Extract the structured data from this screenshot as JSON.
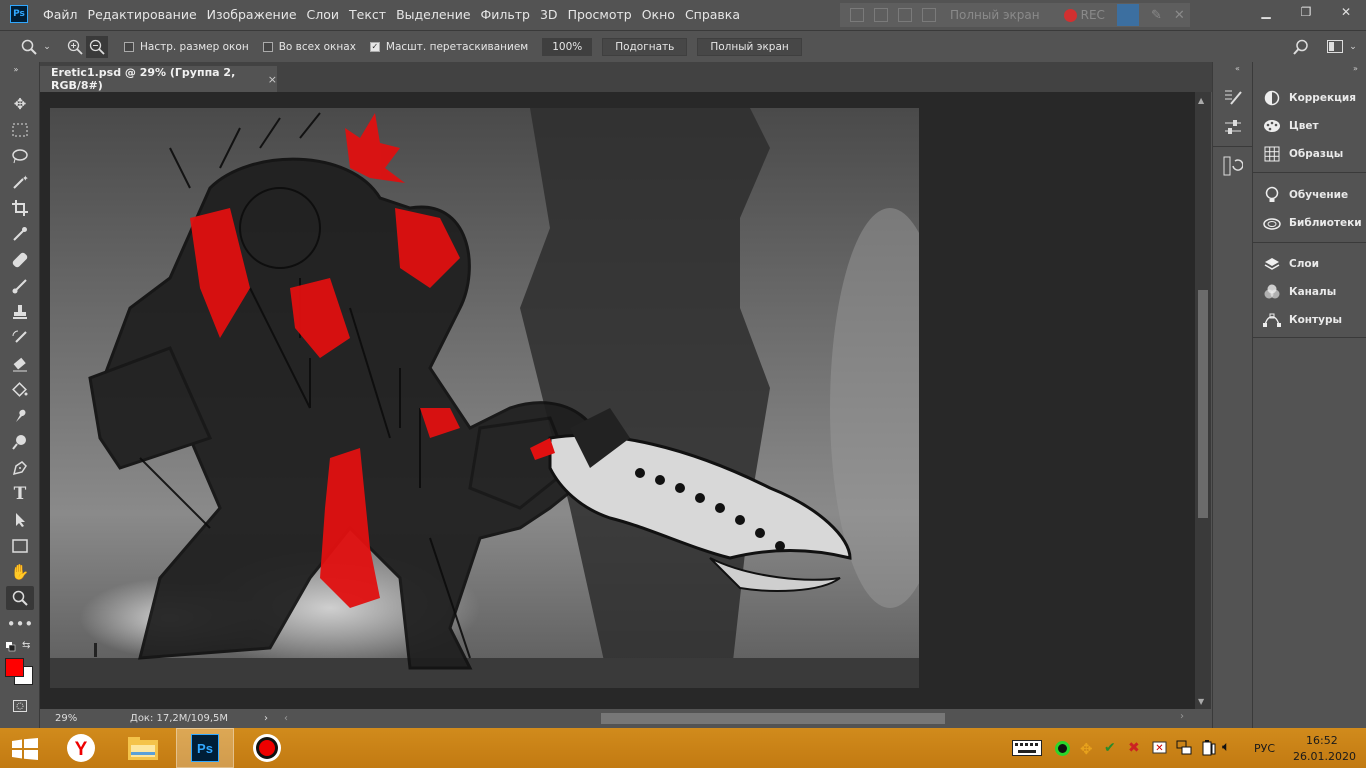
{
  "menu": {
    "items": [
      "Файл",
      "Редактирование",
      "Изображение",
      "Слои",
      "Текст",
      "Выделение",
      "Фильтр",
      "3D",
      "Просмотр",
      "Окно",
      "Справка"
    ]
  },
  "recorder": {
    "fullscreen_label": "Полный экран",
    "rec_label": "REC"
  },
  "options": {
    "resize_windows_label": "Настр. размер окон",
    "resize_windows_checked": false,
    "all_windows_label": "Во всех окнах",
    "all_windows_checked": false,
    "scrubby_zoom_label": "Масшт. перетаскиванием",
    "scrubby_zoom_checked": true,
    "zoom_value": "100%",
    "fit_screen_label": "Подогнать",
    "fill_screen_label": "Полный экран"
  },
  "document": {
    "tab_title": "Eretic1.psd @ 29% (Группа 2, RGB/8#)",
    "close_glyph": "×",
    "zoom": "29%",
    "doc_size": "Док: 17,2M/109,5M"
  },
  "panels": {
    "items": [
      {
        "label": "Коррекция",
        "icon": "adjustments-icon"
      },
      {
        "label": "Цвет",
        "icon": "color-palette-icon"
      },
      {
        "label": "Образцы",
        "icon": "swatches-grid-icon"
      },
      {
        "label": "Обучение",
        "icon": "lightbulb-icon"
      },
      {
        "label": "Библиотеки",
        "icon": "cloud-libraries-icon"
      },
      {
        "label": "Слои",
        "icon": "layers-icon"
      },
      {
        "label": "Каналы",
        "icon": "channels-icon"
      },
      {
        "label": "Контуры",
        "icon": "paths-icon"
      }
    ]
  },
  "colors": {
    "foreground": "#ff0000",
    "background": "#ffffff",
    "taskbar": "#c98316",
    "accent_ps": "#31a8ff"
  },
  "taskbar": {
    "lang": "РУС",
    "time": "16:52",
    "date": "26.01.2020"
  }
}
